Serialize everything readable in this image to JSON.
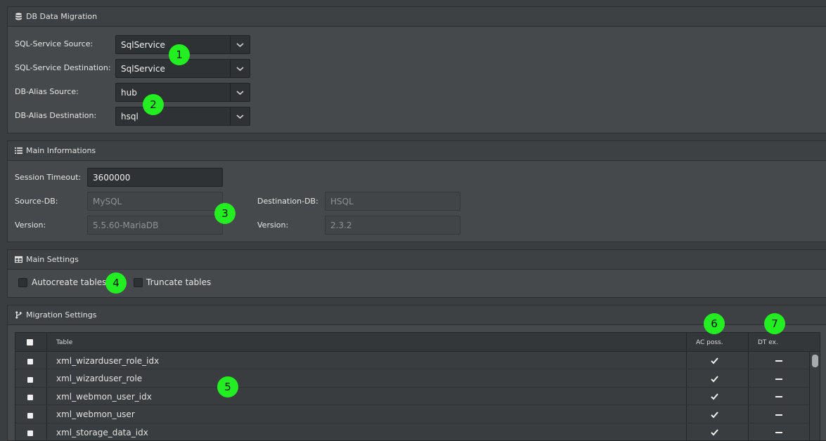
{
  "panels": {
    "migration": {
      "title": "DB Data Migration",
      "icon": "database-icon"
    },
    "main_info": {
      "title": "Main Informations",
      "icon": "list-icon"
    },
    "main_settings": {
      "title": "Main Settings",
      "icon": "table-icon"
    },
    "migration_settings": {
      "title": "Migration Settings",
      "icon": "branch-icon"
    }
  },
  "migration": {
    "sql_source_label": "SQL-Service Source:",
    "sql_source_value": "SqlService",
    "sql_dest_label": "SQL-Service Destination:",
    "sql_dest_value": "SqlService",
    "alias_source_label": "DB-Alias Source:",
    "alias_source_value": "hub",
    "alias_dest_label": "DB-Alias Destination:",
    "alias_dest_value": "hsql"
  },
  "info": {
    "timeout_label": "Session Timeout:",
    "timeout_value": "3600000",
    "source_db_label": "Source-DB:",
    "source_db_value": "MySQL",
    "source_version_label": "Version:",
    "source_version_value": "5.5.60-MariaDB",
    "dest_db_label": "Destination-DB:",
    "dest_db_value": "HSQL",
    "dest_version_label": "Version:",
    "dest_version_value": "2.3.2"
  },
  "settings": {
    "autocreate_label": "Autocreate tables",
    "truncate_label": "Truncate tables"
  },
  "table": {
    "col_table": "Table",
    "col_ac": "AC poss.",
    "col_dt": "DT ex.",
    "rows": [
      {
        "name": "xml_wizarduser_role_idx",
        "ac": "check-icon",
        "dt": "dash-icon"
      },
      {
        "name": "xml_wizarduser_role",
        "ac": "check-icon",
        "dt": "dash-icon"
      },
      {
        "name": "xml_webmon_user_idx",
        "ac": "check-icon",
        "dt": "dash-icon"
      },
      {
        "name": "xml_webmon_user",
        "ac": "check-icon",
        "dt": "dash-icon"
      },
      {
        "name": "xml_storage_data_idx",
        "ac": "check-icon",
        "dt": "dash-icon"
      }
    ]
  },
  "markers": [
    "1",
    "2",
    "3",
    "4",
    "5",
    "6",
    "7"
  ],
  "colors": {
    "marker": "#22ee22",
    "background": "#3b3e40",
    "panel": "#45494b"
  }
}
